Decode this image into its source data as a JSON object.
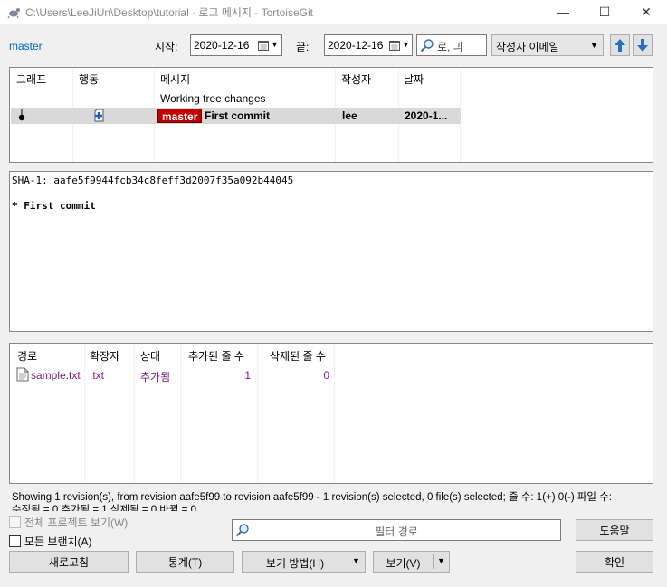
{
  "window": {
    "title": "C:\\Users\\LeeJiUn\\Desktop\\tutorial - 로그 메시지 - TortoiseGit",
    "minimize": "—",
    "maximize": "☐",
    "close": "✕"
  },
  "toolbar": {
    "branch": "master",
    "start_label": "시작:",
    "start_date": "2020-12-16",
    "end_label": "끝:",
    "end_date": "2020-12-16",
    "search_value": "로, 긔",
    "filter_type": "작성자 이메일"
  },
  "log": {
    "columns": [
      "그래프",
      "행동",
      "메시지",
      "작성자",
      "날짜"
    ],
    "working_tree": "Working tree changes",
    "row": {
      "branch_tag": "master",
      "message": "First commit",
      "author": "lee",
      "date": "2020-1..."
    }
  },
  "commit": {
    "sha_line": "SHA-1: aafe5f9944fcb34c8feff3d2007f35a092b44045",
    "message_line": "* First commit"
  },
  "files": {
    "columns": [
      "경로",
      "확장자",
      "상태",
      "추가된 줄 수",
      "삭제된 줄 수"
    ],
    "rows": [
      {
        "path": "sample.txt",
        "ext": ".txt",
        "status": "추가됨",
        "added": "1",
        "removed": "0"
      }
    ]
  },
  "status": {
    "line1": "Showing 1 revision(s), from revision aafe5f99 to revision aafe5f99 - 1 revision(s) selected, 0 file(s) selected; 줄 수: 1(+) 0(-) 파일 수:",
    "line2": "수정됨 = 0 추가됨 = 1 삭제됨 = 0 바뀜 = 0"
  },
  "options": {
    "whole_project": "전체 프로젝트 보기(W)",
    "all_branches": "모든 브랜치(A)",
    "path_filter_placeholder": "필터 경로"
  },
  "buttons": {
    "help": "도움말",
    "refresh": "새로고침",
    "stats": "통계(T)",
    "view_mode": "보기 방법(H)",
    "view": "보기(V)",
    "ok": "확인"
  },
  "colors": {
    "branch_tag_bg": "#c00000",
    "selected_row_bg": "#d9d9d9",
    "file_link": "#7a1d7a",
    "nav_arrow": "#2b6cc4"
  }
}
